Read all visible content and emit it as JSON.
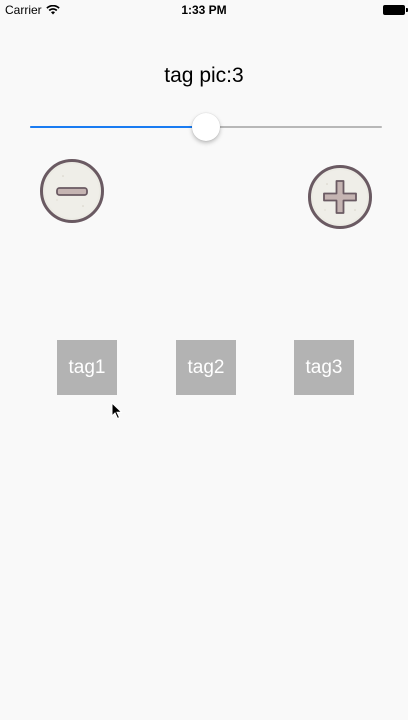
{
  "status_bar": {
    "carrier": "Carrier",
    "time": "1:33 PM",
    "wifi_icon": "wifi-icon",
    "battery_icon": "battery-icon"
  },
  "title": "tag pic:3",
  "slider": {
    "value_fraction": 0.5,
    "fill_color": "#1a7cf2",
    "track_color": "#b8b8b8"
  },
  "buttons": {
    "minus_icon": "minus-icon",
    "plus_icon": "plus-icon"
  },
  "tags": [
    {
      "label": "tag1"
    },
    {
      "label": "tag2"
    },
    {
      "label": "tag3"
    }
  ],
  "colors": {
    "tag_background": "#b3b3b3",
    "button_border": "#6a5a62",
    "button_fill": "#ecebe4"
  }
}
